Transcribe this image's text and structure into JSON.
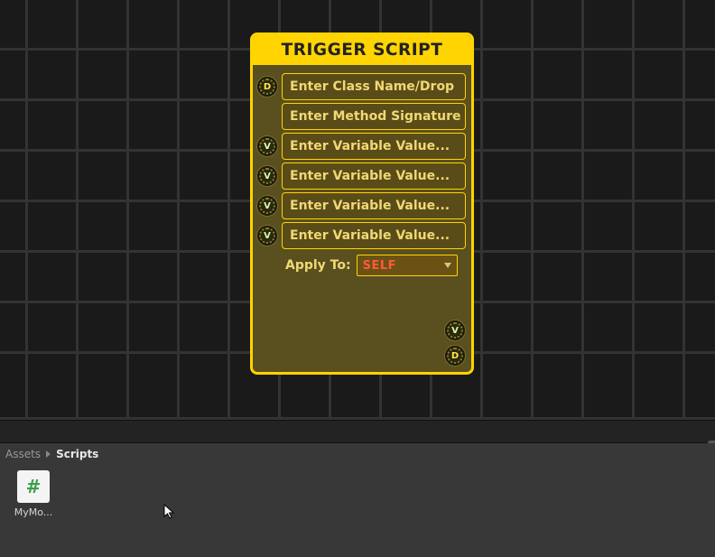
{
  "node": {
    "title": "TRIGGER SCRIPT",
    "fields": {
      "class_name": {
        "placeholder": "Enter Class Name/Drop"
      },
      "method_sig": {
        "placeholder": "Enter Method Signature"
      },
      "var1": {
        "placeholder": "Enter Variable Value..."
      },
      "var2": {
        "placeholder": "Enter Variable Value..."
      },
      "var3": {
        "placeholder": "Enter Variable Value..."
      },
      "var4": {
        "placeholder": "Enter Variable Value..."
      }
    },
    "apply_to": {
      "label": "Apply To:",
      "value": "SELF"
    },
    "ports": {
      "d": "D",
      "v": "V"
    }
  },
  "browser": {
    "crumbs": [
      "Assets",
      "Scripts"
    ],
    "items": [
      {
        "name": "MyMo..."
      }
    ]
  }
}
